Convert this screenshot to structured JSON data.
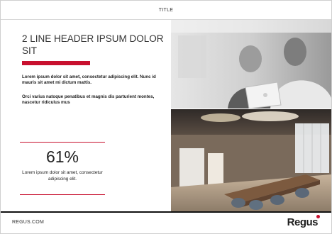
{
  "header": {
    "title": "TITLE"
  },
  "main": {
    "headline": "2 LINE HEADER IPSUM DOLOR SIT",
    "paragraphs": [
      "Lorem ipsum dolor sit amet, consectetur adipiscing elit. Nunc id mauris sit amet mi dictum mattis.",
      "Orci varius natoque penatibus et magnis dis parturient montes, nascetur ridiculus mus"
    ],
    "stat": {
      "value": "61%",
      "caption": "Lorem ipsum dolor sit amet, consectetur adipiscing elit."
    }
  },
  "footer": {
    "url": "REGUS.COM",
    "logo": "Regus"
  },
  "colors": {
    "accent": "#c8102e",
    "text": "#222222",
    "rule": "#111111"
  },
  "images": [
    {
      "name": "two-men-laptop-photo"
    },
    {
      "name": "office-meeting-room-photo"
    }
  ]
}
